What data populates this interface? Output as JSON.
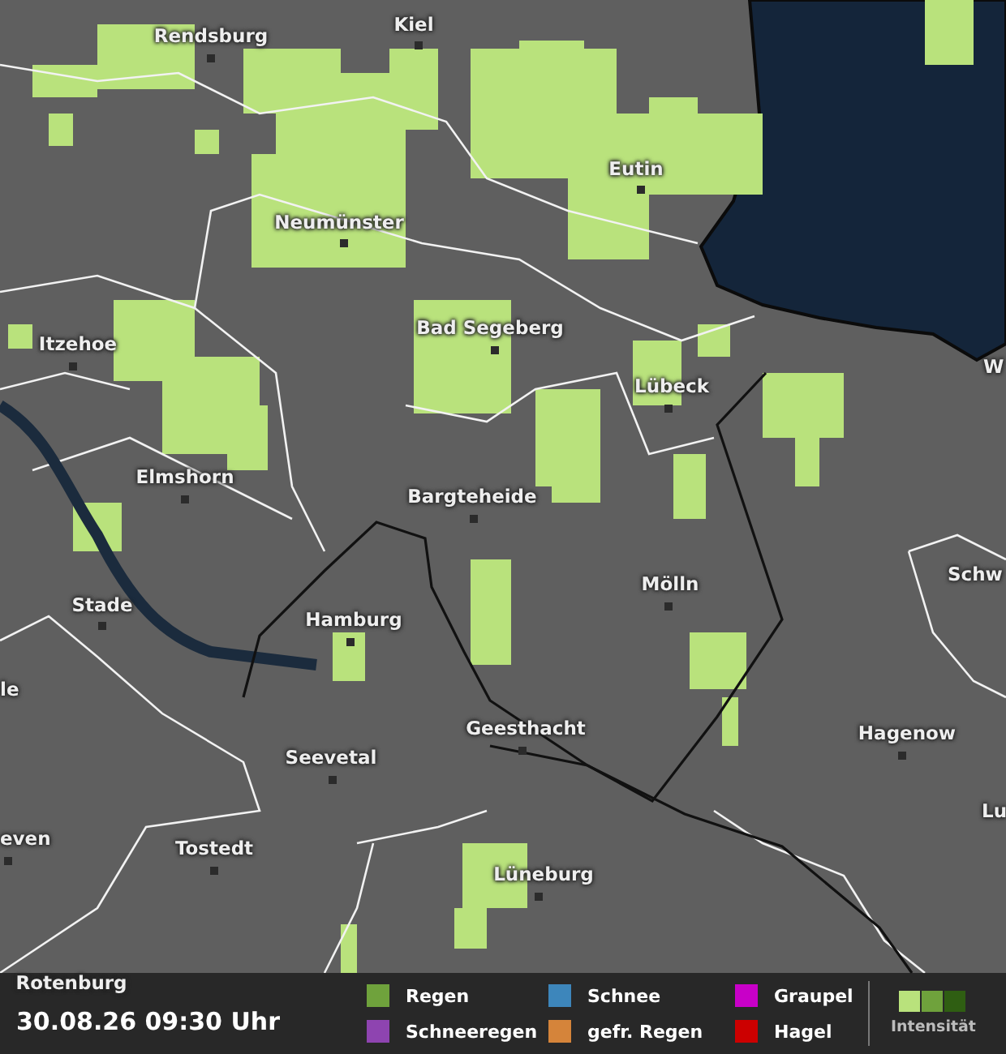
{
  "map": {
    "places": [
      {
        "name": "Rendsburg"
      },
      {
        "name": "Kiel"
      },
      {
        "name": "Eutin"
      },
      {
        "name": "Neumünster"
      },
      {
        "name": "Bad Segeberg"
      },
      {
        "name": "Itzehoe"
      },
      {
        "name": "Lübeck"
      },
      {
        "name": "W"
      },
      {
        "name": "Elmshorn"
      },
      {
        "name": "Bargteheide"
      },
      {
        "name": "Stade"
      },
      {
        "name": "Mölln"
      },
      {
        "name": "Schw"
      },
      {
        "name": "Hamburg"
      },
      {
        "name": "le"
      },
      {
        "name": "Geesthacht"
      },
      {
        "name": "Hagenow"
      },
      {
        "name": "Seevetal"
      },
      {
        "name": "Lu"
      },
      {
        "name": "even"
      },
      {
        "name": "Tostedt"
      },
      {
        "name": "Lüneburg"
      },
      {
        "name": "Rotenburg"
      }
    ]
  },
  "legend": {
    "timestamp": "30.08.26 09:30 Uhr",
    "precipitation_types": [
      {
        "label": "Regen",
        "color": "#6fa23c"
      },
      {
        "label": "Schneeregen",
        "color": "#8e44b0"
      },
      {
        "label": "Schnee",
        "color": "#3d86bb"
      },
      {
        "label": "gefr. Regen",
        "color": "#d5843a"
      },
      {
        "label": "Graupel",
        "color": "#c800c8"
      },
      {
        "label": "Hagel",
        "color": "#cc0000"
      }
    ],
    "intensity": {
      "label": "Intensität"
    }
  }
}
